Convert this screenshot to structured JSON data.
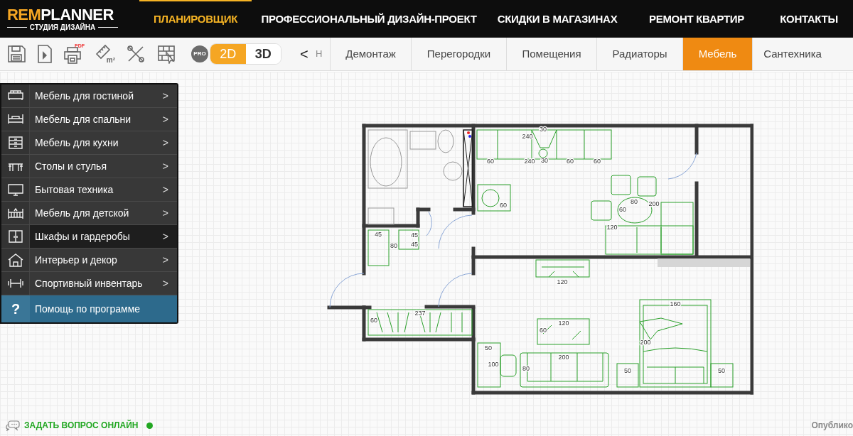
{
  "logo": {
    "brand_accent": "REM",
    "brand_rest": "PLANNER",
    "tagline": "СТУДИЯ ДИЗАЙНА"
  },
  "nav": [
    {
      "label": "ПЛАНИРОВЩИК",
      "selected": true
    },
    {
      "label": "ПРОФЕССИОНАЛЬНЫЙ ДИЗАЙН-ПРОЕКТ",
      "selected": false
    },
    {
      "label": "СКИДКИ В МАГАЗИНАХ",
      "selected": false
    },
    {
      "label": "РЕМОНТ КВАРТИР",
      "selected": false
    },
    {
      "label": "КОНТАКТЫ",
      "selected": false
    }
  ],
  "toolbar": {
    "pro_badge": "PRO",
    "pdf_label": "PDF",
    "area_label": "m²",
    "view_modes": [
      {
        "label": "2D",
        "selected": true
      },
      {
        "label": "3D",
        "selected": false
      }
    ],
    "scroll_left": "<",
    "hidden_tab_fragment": "Н"
  },
  "tabs": [
    {
      "label": "Демонтаж",
      "selected": false
    },
    {
      "label": "Перегородки",
      "selected": false
    },
    {
      "label": "Помещения",
      "selected": false
    },
    {
      "label": "Радиаторы",
      "selected": false
    },
    {
      "label": "Мебель",
      "selected": true
    },
    {
      "label": "Сантехника",
      "selected": false
    }
  ],
  "furniture_menu": [
    {
      "kind": "category",
      "label": "Мебель для гостиной",
      "arrow": ">",
      "highlighted": false
    },
    {
      "kind": "category",
      "label": "Мебель для спальни",
      "arrow": ">",
      "highlighted": false
    },
    {
      "kind": "category",
      "label": "Мебель для кухни",
      "arrow": ">",
      "highlighted": false
    },
    {
      "kind": "category",
      "label": "Столы и стулья",
      "arrow": ">",
      "highlighted": false
    },
    {
      "kind": "category",
      "label": "Бытовая техника",
      "arrow": ">",
      "highlighted": false
    },
    {
      "kind": "category",
      "label": "Мебель для детской",
      "arrow": ">",
      "highlighted": false
    },
    {
      "kind": "category",
      "label": "Шкафы и гардеробы",
      "arrow": ">",
      "highlighted": true
    },
    {
      "kind": "category",
      "label": "Интерьер и декор",
      "arrow": ">",
      "highlighted": false
    },
    {
      "kind": "category",
      "label": "Спортивный инвентарь",
      "arrow": ">",
      "highlighted": false
    },
    {
      "kind": "help",
      "icon_text": "?",
      "label": "Помощь по программе"
    }
  ],
  "floor_plan": {
    "dimension_labels": [
      "240",
      "30",
      "60",
      "240",
      "30",
      "60",
      "60",
      "60",
      "80",
      "60",
      "200",
      "120",
      "45",
      "45",
      "45",
      "80",
      "120",
      "237",
      "60",
      "160",
      "120",
      "60",
      "200",
      "50",
      "200",
      "100",
      "80",
      "50",
      "50"
    ]
  },
  "footer": {
    "chat_link": "ЗАДАТЬ ВОПРОС ОНЛАЙН",
    "online": true,
    "right_text": "Опублико"
  }
}
